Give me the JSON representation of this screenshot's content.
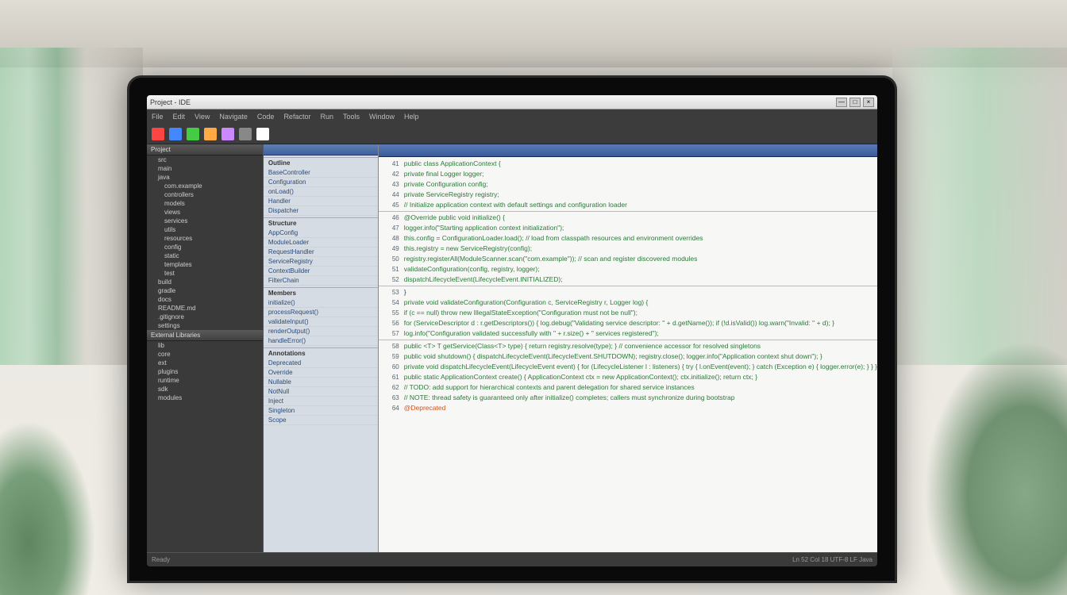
{
  "window": {
    "title": "Project - IDE",
    "close": "×",
    "max": "□",
    "min": "—"
  },
  "menu": [
    "File",
    "Edit",
    "View",
    "Navigate",
    "Code",
    "Refactor",
    "Run",
    "Tools",
    "Window",
    "Help"
  ],
  "left": {
    "section1": "Project",
    "section2": "External Libraries",
    "items1": [
      "src",
      "main",
      "java",
      "com.example",
      "controllers",
      "models",
      "views",
      "services",
      "utils",
      "resources",
      "config",
      "static",
      "templates",
      "test",
      "build",
      "gradle",
      "docs",
      "README.md",
      ".gitignore",
      "settings"
    ],
    "items2": [
      "lib",
      "core",
      "ext",
      "plugins",
      "runtime",
      "sdk",
      "modules"
    ]
  },
  "middle": {
    "group1": "Outline",
    "items1": [
      "BaseController",
      "Configuration",
      "onLoad()",
      "Handler",
      "Dispatcher"
    ],
    "group2": "Structure",
    "items2": [
      "AppConfig",
      "ModuleLoader",
      "RequestHandler",
      "ServiceRegistry",
      "ContextBuilder",
      "FilterChain"
    ],
    "group3": "Members",
    "items3": [
      "initialize()",
      "processRequest()",
      "validateInput()",
      "renderOutput()",
      "handleError()"
    ],
    "group4": "Annotations",
    "items4": [
      "Deprecated",
      "Override",
      "Nullable",
      "NotNull",
      "Inject",
      "Singleton",
      "Scope"
    ]
  },
  "editor": {
    "lines": [
      {
        "n": "41",
        "t": "public class ApplicationContext {",
        "style": "code"
      },
      {
        "n": "42",
        "t": "  private final Logger logger;",
        "style": "code"
      },
      {
        "n": "43",
        "t": "  private Configuration config;",
        "style": "code"
      },
      {
        "n": "44",
        "t": "  private ServiceRegistry registry;",
        "style": "code"
      },
      {
        "n": "45",
        "t": "  // Initialize application context with default settings and configuration loader",
        "style": "code"
      },
      {
        "n": "",
        "t": "",
        "style": "divider"
      },
      {
        "n": "46",
        "t": "  @Override public void initialize() {",
        "style": "code"
      },
      {
        "n": "47",
        "t": "    logger.info(\"Starting application context initialization\");",
        "style": "code"
      },
      {
        "n": "48",
        "t": "    this.config = ConfigurationLoader.load(); // load from classpath resources and environment overrides",
        "style": "code"
      },
      {
        "n": "49",
        "t": "    this.registry = new ServiceRegistry(config);",
        "style": "code"
      },
      {
        "n": "50",
        "t": "    registry.registerAll(ModuleScanner.scan(\"com.example\")); // scan and register discovered modules",
        "style": "code"
      },
      {
        "n": "51",
        "t": "    validateConfiguration(config, registry, logger);",
        "style": "code"
      },
      {
        "n": "52",
        "t": "    dispatchLifecycleEvent(LifecycleEvent.INITIALIZED);",
        "style": "code"
      },
      {
        "n": "",
        "t": "",
        "style": "divider"
      },
      {
        "n": "53",
        "t": "  }",
        "style": "dark"
      },
      {
        "n": "54",
        "t": "  private void validateConfiguration(Configuration c, ServiceRegistry r, Logger log) {",
        "style": "code"
      },
      {
        "n": "55",
        "t": "    if (c == null) throw new IllegalStateException(\"Configuration must not be null\");",
        "style": "code"
      },
      {
        "n": "56",
        "t": "    for (ServiceDescriptor d : r.getDescriptors()) { log.debug(\"Validating service descriptor: \" + d.getName()); if (!d.isValid()) log.warn(\"Invalid: \" + d); }",
        "style": "code"
      },
      {
        "n": "57",
        "t": "    log.info(\"Configuration validated successfully with \" + r.size() + \" services registered\");",
        "style": "code"
      },
      {
        "n": "",
        "t": "",
        "style": "divider"
      },
      {
        "n": "58",
        "t": "  public <T> T getService(Class<T> type) { return registry.resolve(type); } // convenience accessor for resolved singletons",
        "style": "code"
      },
      {
        "n": "59",
        "t": "  public void shutdown() { dispatchLifecycleEvent(LifecycleEvent.SHUTDOWN); registry.close(); logger.info(\"Application context shut down\"); }",
        "style": "code"
      },
      {
        "n": "60",
        "t": "  private void dispatchLifecycleEvent(LifecycleEvent event) { for (LifecycleListener l : listeners) { try { l.onEvent(event); } catch (Exception e) { logger.error(e); } } }",
        "style": "code"
      },
      {
        "n": "61",
        "t": "  public static ApplicationContext create() { ApplicationContext ctx = new ApplicationContext(); ctx.initialize(); return ctx; }",
        "style": "code"
      },
      {
        "n": "62",
        "t": "  // TODO: add support for hierarchical contexts and parent delegation for shared service instances",
        "style": "code"
      },
      {
        "n": "63",
        "t": "  // NOTE: thread safety is guaranteed only after initialize() completes; callers must synchronize during bootstrap",
        "style": "code"
      },
      {
        "n": "64",
        "t": "  @Deprecated",
        "style": "red"
      }
    ]
  },
  "status": {
    "left": "Ready",
    "right": "Ln 52  Col 18   UTF-8   LF   Java"
  }
}
